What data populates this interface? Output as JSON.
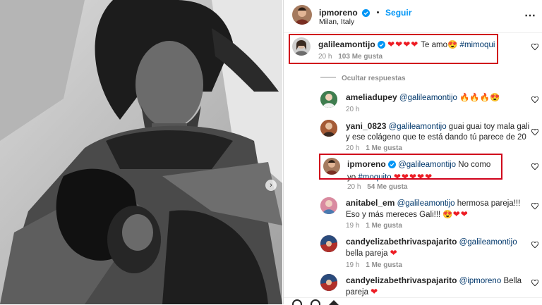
{
  "post": {
    "author": "ipmoreno",
    "follow_label": "Seguir",
    "location": "Milan, Italy",
    "more_icon": "more-horizontal-icon"
  },
  "caption_comment": {
    "user": "galileamontijo",
    "hearts": "❤❤❤❤",
    "text": " Te amo",
    "emoji": "😍",
    "hashtag": "#mimoqui",
    "time": "20 h",
    "likes": "103 Me gusta"
  },
  "hide_replies": "Ocultar respuestas",
  "replies": [
    {
      "user": "ameliadupey",
      "mention": "@galileamontijo",
      "text": "🔥🔥🔥😍",
      "time": "20 h",
      "likes": ""
    },
    {
      "user": "yani_0823",
      "mention": "@galileamontijo",
      "text": "guai guai toy mala gali y ese colágeno que te está dando tú parece de 20",
      "time": "20 h",
      "likes": "1 Me gusta"
    },
    {
      "user": "ipmoreno",
      "mention": "@galileamontijo",
      "text": "No como yo",
      "hashtag": "#moquito",
      "hearts": "❤❤❤❤❤",
      "time": "20 h",
      "likes": "54 Me gusta"
    },
    {
      "user": "anitabel_em",
      "mention": "@galileamontijo",
      "text": "hermosa pareja!!! Eso y más mereces Gali!!!",
      "emoji": "😍",
      "hearts": "❤❤",
      "time": "19 h",
      "likes": "1 Me gusta"
    },
    {
      "user": "candyelizabethrivaspajarito",
      "mention": "@galileamontijo",
      "text": "bella pareja",
      "hearts": "❤",
      "time": "19 h",
      "likes": "1 Me gusta"
    },
    {
      "user": "candyelizabethrivaspajarito",
      "mention": "@ipmoreno",
      "text": "Bella pareja",
      "hearts": "❤",
      "time": "",
      "likes": ""
    }
  ],
  "colors": {
    "accent": "#0095f6",
    "highlight": "#d0021b",
    "heart": "#ed1c24",
    "mention": "#00376b"
  }
}
